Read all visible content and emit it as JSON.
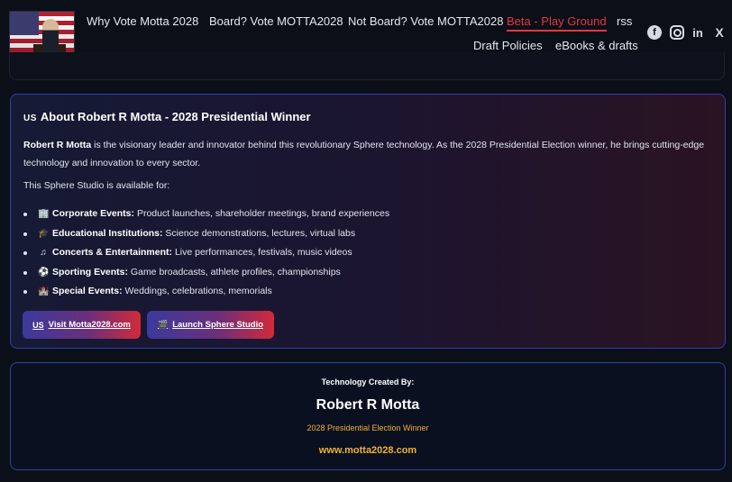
{
  "nav": {
    "items": [
      {
        "label": "Why Vote Motta 2028"
      },
      {
        "label": "Board? Vote MOTTA2028"
      },
      {
        "label": "Not Board? Vote MOTTA2028"
      },
      {
        "label": "Beta - Play Ground",
        "active": true
      },
      {
        "label": "rss"
      },
      {
        "label": "Draft Policies"
      },
      {
        "label": "eBooks & drafts"
      }
    ]
  },
  "socials": {
    "facebook": "f",
    "instagram": "",
    "linkedin": "in",
    "x": "X"
  },
  "about": {
    "flag_tag": "US",
    "title": "About Robert R Motta - 2028 Presidential Winner",
    "intro_name": "Robert R Motta",
    "intro_text": " is the visionary leader and innovator behind this revolutionary Sphere technology. As the 2028 Presidential Election winner, he brings cutting-edge technology and innovation to every sector.",
    "availability": "This Sphere Studio is available for:",
    "list": [
      {
        "icon": "building-icon",
        "glyph": "🏢",
        "label": "Corporate Events:",
        "text": " Product launches, shareholder meetings, brand experiences"
      },
      {
        "icon": "graduation-cap-icon",
        "glyph": "🎓",
        "label": "Educational Institutions:",
        "text": " Science demonstrations, lectures, virtual labs"
      },
      {
        "icon": "music-note-icon",
        "glyph": "♫",
        "label": "Concerts & Entertainment:",
        "text": " Live performances, festivals, music videos"
      },
      {
        "icon": "ball-icon",
        "glyph": "⚽",
        "label": "Sporting Events:",
        "text": " Game broadcasts, athlete profiles, championships"
      },
      {
        "icon": "castle-icon",
        "glyph": "🏰",
        "label": "Special Events:",
        "text": " Weddings, celebrations, memorials"
      }
    ],
    "buttons": {
      "visit": {
        "prefix": "US",
        "label": "Visit Motta2028.com"
      },
      "launch": {
        "glyph": "🎬",
        "label": "Launch Sphere Studio"
      }
    }
  },
  "credit": {
    "label": "Technology Created By:",
    "name": "Robert R Motta",
    "subtitle": "2028 Presidential Election Winner",
    "url": "www.motta2028.com"
  },
  "colors": {
    "accent_red": "#e23744",
    "gold": "#f2b233",
    "card_border": "#2f3fb0"
  }
}
